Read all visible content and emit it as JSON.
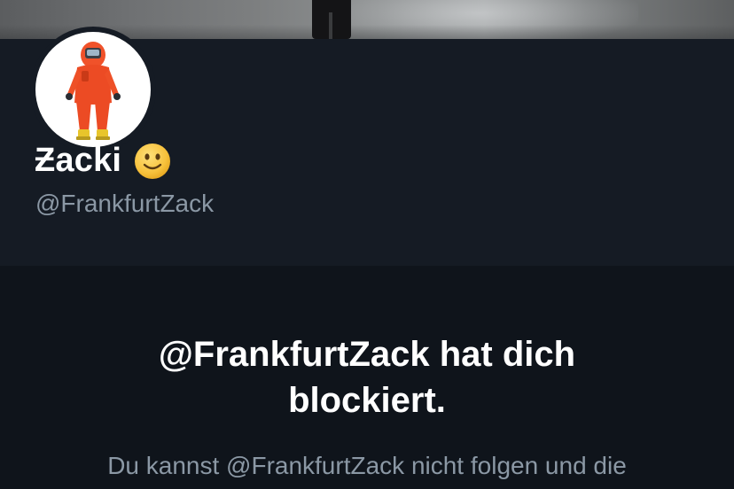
{
  "profile": {
    "display_name": "Ƶacki",
    "emoji_icon": "slightly-smiling-face",
    "handle": "@FrankfurtZack"
  },
  "blocked": {
    "title_line_1": "@FrankfurtZack hat dich",
    "title_line_2": "blockiert.",
    "description": "Du kannst @FrankfurtZack nicht folgen und die"
  },
  "colors": {
    "background": "#151b24",
    "section_background": "#0f141b",
    "primary_text": "#ffffff",
    "secondary_text": "#8b98a5",
    "hazmat_suit": "#f0522a"
  }
}
